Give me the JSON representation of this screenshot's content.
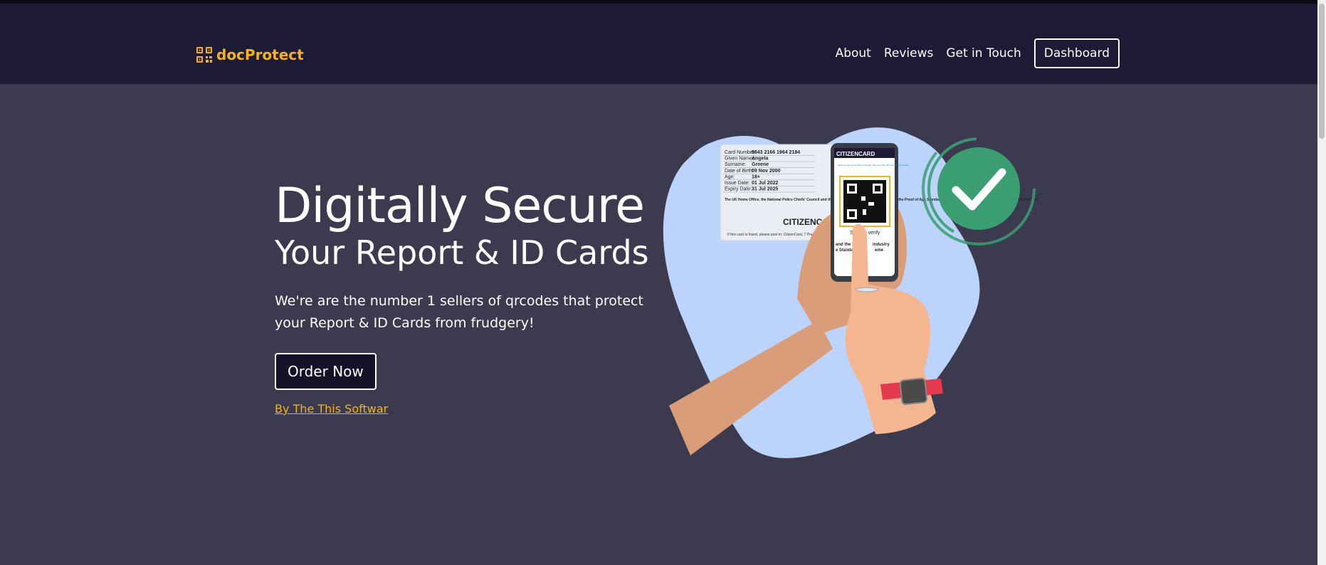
{
  "brand": {
    "name": "docProtect",
    "color": "#f5b21a"
  },
  "nav": {
    "about": "About",
    "reviews": "Reviews",
    "contact": "Get in Touch",
    "dashboard": "Dashboard"
  },
  "hero": {
    "title": "Digitally Secure",
    "subtitle": "Your Report & ID Cards",
    "description": "We're are the number 1 sellers of qrcodes that protect your Report & ID Cards from frudgery!",
    "cta": "Order Now",
    "credit": "By The This Softwar"
  },
  "illustration": {
    "card": {
      "rows": [
        {
          "label": "Card Number:",
          "value": "5843 2166 1964 2184"
        },
        {
          "label": "Given Names:",
          "value": "Angela"
        },
        {
          "label": "Surname:",
          "value": "Greene"
        },
        {
          "label": "Date of Birth:",
          "value": "09 Nov 2000"
        },
        {
          "label": "Age:",
          "value": "18+"
        },
        {
          "label": "Issue Date:",
          "value": "01 Jul 2022"
        },
        {
          "label": "Expiry Date:",
          "value": "31 Jul 2025"
        }
      ],
      "fine_print": "The UK Home Office, the National Police Chiefs' Council and the Authority recognise this card bearing the Proof of Age Standard hologram as a valid form of ID. Verify this card online at",
      "logo": "CITIZENCARD",
      "footer": "If this card is found, please post to: CitizenCard, 7 Press"
    },
    "phone": {
      "logo": "CITIZENCARD",
      "hint": "Move camera closer then prompted, then scan the QR code on card to see",
      "verify": "Scan to verify",
      "line1": "and the S",
      "line1b": "industry",
      "line2": "e Standa",
      "line2b": "eme"
    },
    "check_color": "#3a9e72",
    "blob_color": "#bcd4fb"
  }
}
